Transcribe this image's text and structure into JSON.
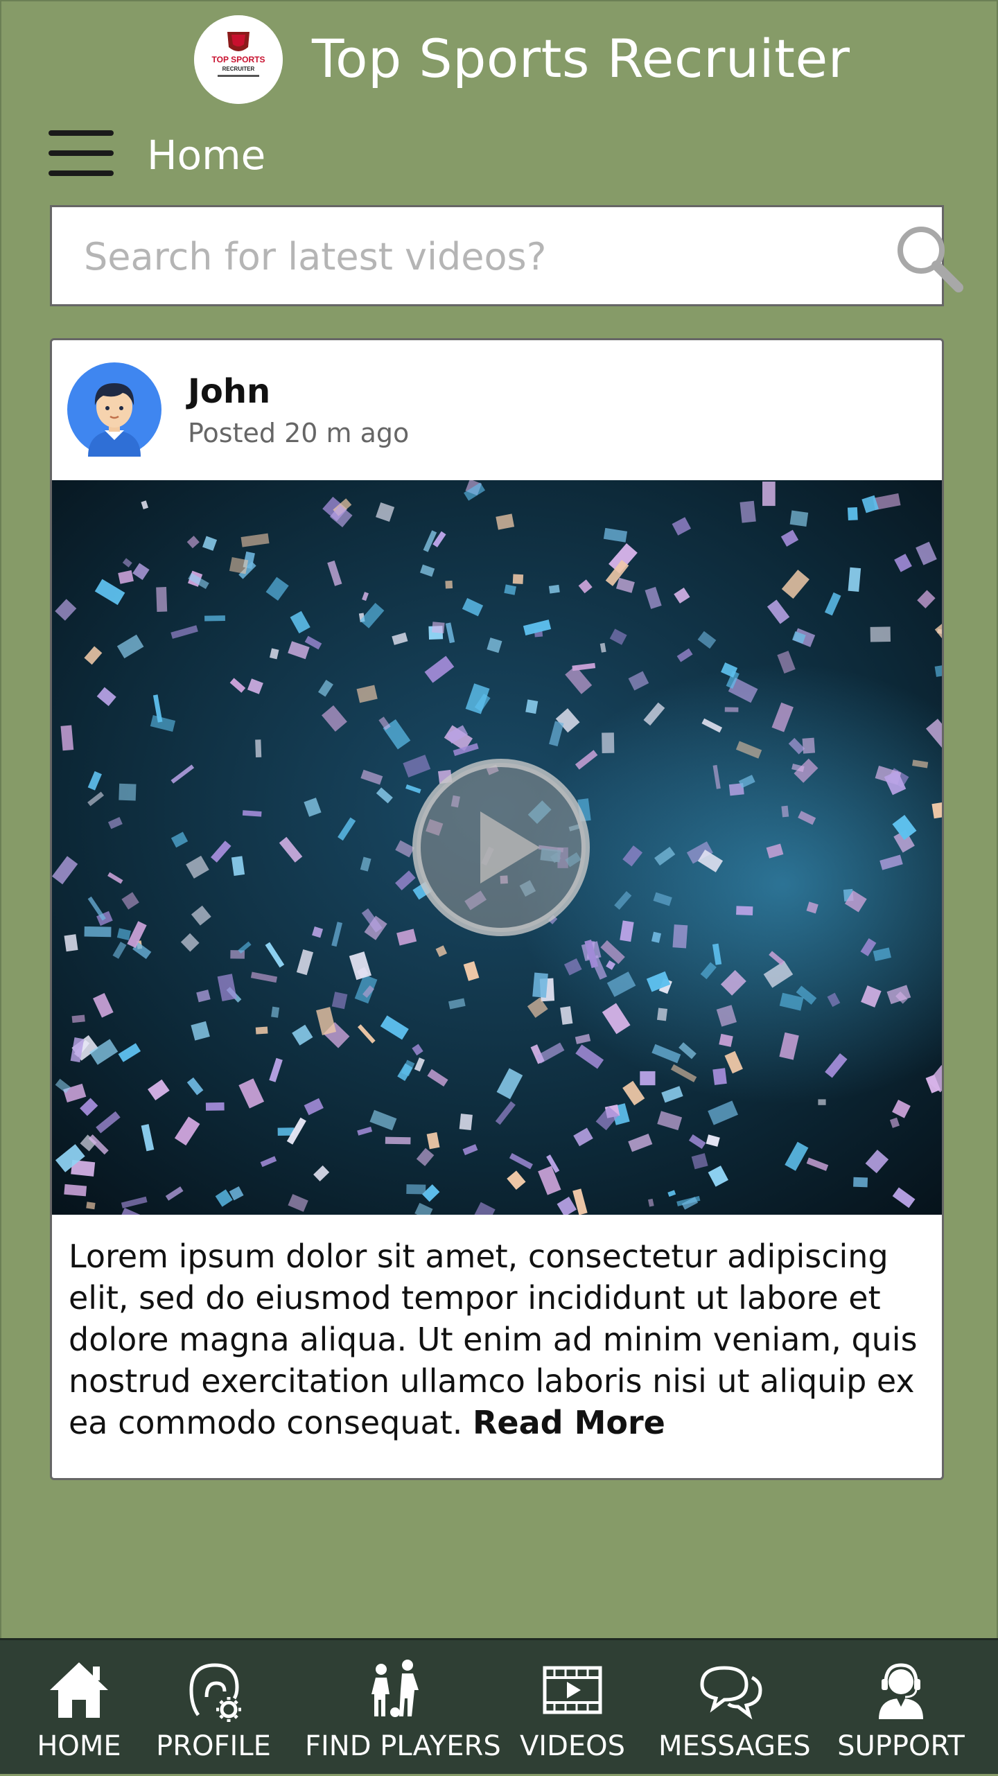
{
  "header": {
    "app_title": "Top Sports Recruiter",
    "logo_text": "TOP SPORTS RECRUITER"
  },
  "nav": {
    "page_title": "Home"
  },
  "search": {
    "placeholder": "Search for latest videos?",
    "value": ""
  },
  "post": {
    "author": "John",
    "time": "Posted 20 m ago",
    "body": "Lorem ipsum dolor sit amet, consectetur adipiscing elit, sed do eiusmod tempor incididunt ut labore et dolore magna aliqua. Ut enim ad minim veniam, quis nostrud exercitation ullamco laboris nisi ut aliquip ex ea commodo consequat.",
    "read_more": "Read More"
  },
  "bottom_nav": {
    "items": [
      {
        "label": "HOME",
        "icon": "home-icon"
      },
      {
        "label": "PROFILE",
        "icon": "profile-settings-icon"
      },
      {
        "label": "FIND PLAYERS",
        "icon": "players-icon"
      },
      {
        "label": "VIDEOS",
        "icon": "video-icon"
      },
      {
        "label": "MESSAGES",
        "icon": "chat-icon"
      },
      {
        "label": "SUPPORT",
        "icon": "support-agent-icon"
      }
    ]
  },
  "colors": {
    "background": "#869b68",
    "bottom_nav": "#2f3f34",
    "avatar_bg": "#3f86f0",
    "logo_red": "#c8102e"
  }
}
